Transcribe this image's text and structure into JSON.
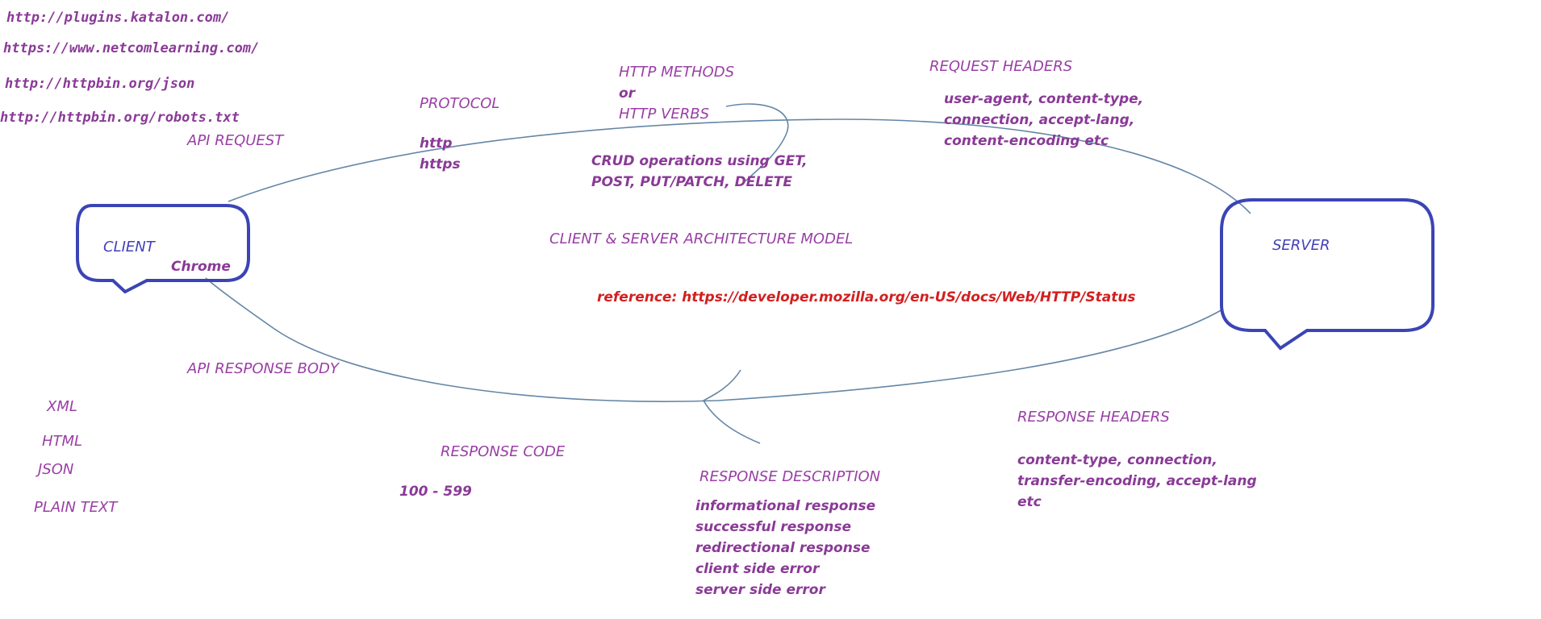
{
  "urls": [
    "http://plugins.katalon.com/",
    "https://www.netcomlearning.com/",
    "http://httpbin.org/json",
    "http://httpbin.org/robots.txt"
  ],
  "labels": {
    "api_request": "API REQUEST",
    "protocol": "PROTOCOL",
    "protocol_items": [
      "http",
      "https"
    ],
    "http_methods": "HTTP METHODS",
    "or": "or",
    "http_verbs": "HTTP VERBS",
    "crud_line1": "CRUD operations using GET,",
    "crud_line2": "POST, PUT/PATCH, DELETE",
    "request_headers": "REQUEST HEADERS",
    "request_headers_items": [
      "user-agent, content-type,",
      "connection, accept-lang,",
      "content-encoding etc"
    ],
    "client": "CLIENT",
    "chrome": "Chrome",
    "server": "SERVER",
    "title": "CLIENT & SERVER ARCHITECTURE MODEL",
    "reference": "reference: https://developer.mozilla.org/en-US/docs/Web/HTTP/Status",
    "api_response_body": "API RESPONSE BODY",
    "body_types": [
      "XML",
      "HTML",
      "JSON",
      "PLAIN TEXT"
    ],
    "response_code": "RESPONSE CODE",
    "response_code_range": "100 - 599",
    "response_description": "RESPONSE DESCRIPTION",
    "response_description_items": [
      "informational response",
      "successful response",
      "redirectional response",
      "client side error",
      "server side error"
    ],
    "response_headers": "RESPONSE HEADERS",
    "response_headers_items": [
      "content-type, connection,",
      "transfer-encoding, accept-lang",
      "etc"
    ]
  },
  "colors": {
    "text": "#8a3a97",
    "node_text": "#4242b8",
    "node_border": "#3b44b5",
    "arrow": "#6486a6",
    "reference": "#d21f1f"
  }
}
